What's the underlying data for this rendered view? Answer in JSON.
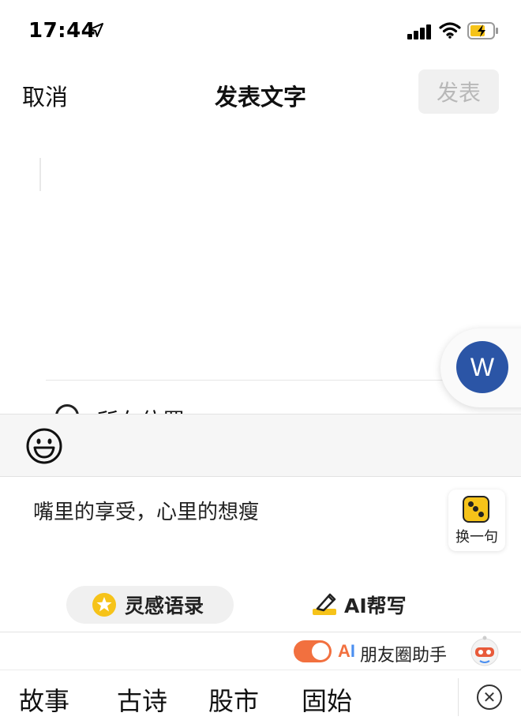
{
  "status_bar": {
    "time": "17:44",
    "battery_color": "#f6c319",
    "icons": [
      "location-arrow-icon",
      "signal-icon",
      "wifi-icon",
      "battery-charging-icon"
    ]
  },
  "nav": {
    "cancel_label": "取消",
    "title": "发表文字",
    "publish_label": "发表"
  },
  "location": {
    "label": "所在位置",
    "chevron": "›"
  },
  "float_bubble": {
    "letter": "W",
    "color": "#2b55a6"
  },
  "suggestion": {
    "text": "嘴里的享受，心里的想瘦",
    "shuffle_label": "换一句"
  },
  "tools": {
    "inspiration_label": "灵感语录",
    "ai_write_label": "AI帮写"
  },
  "assistant": {
    "ai_a": "A",
    "ai_i": "I",
    "label": "朋友圈助手",
    "toggle_on": true,
    "toggle_color": "#f2703f"
  },
  "keyboard": {
    "candidates": [
      "故事",
      "古诗",
      "股市",
      "固始"
    ],
    "close_glyph": "✕"
  }
}
